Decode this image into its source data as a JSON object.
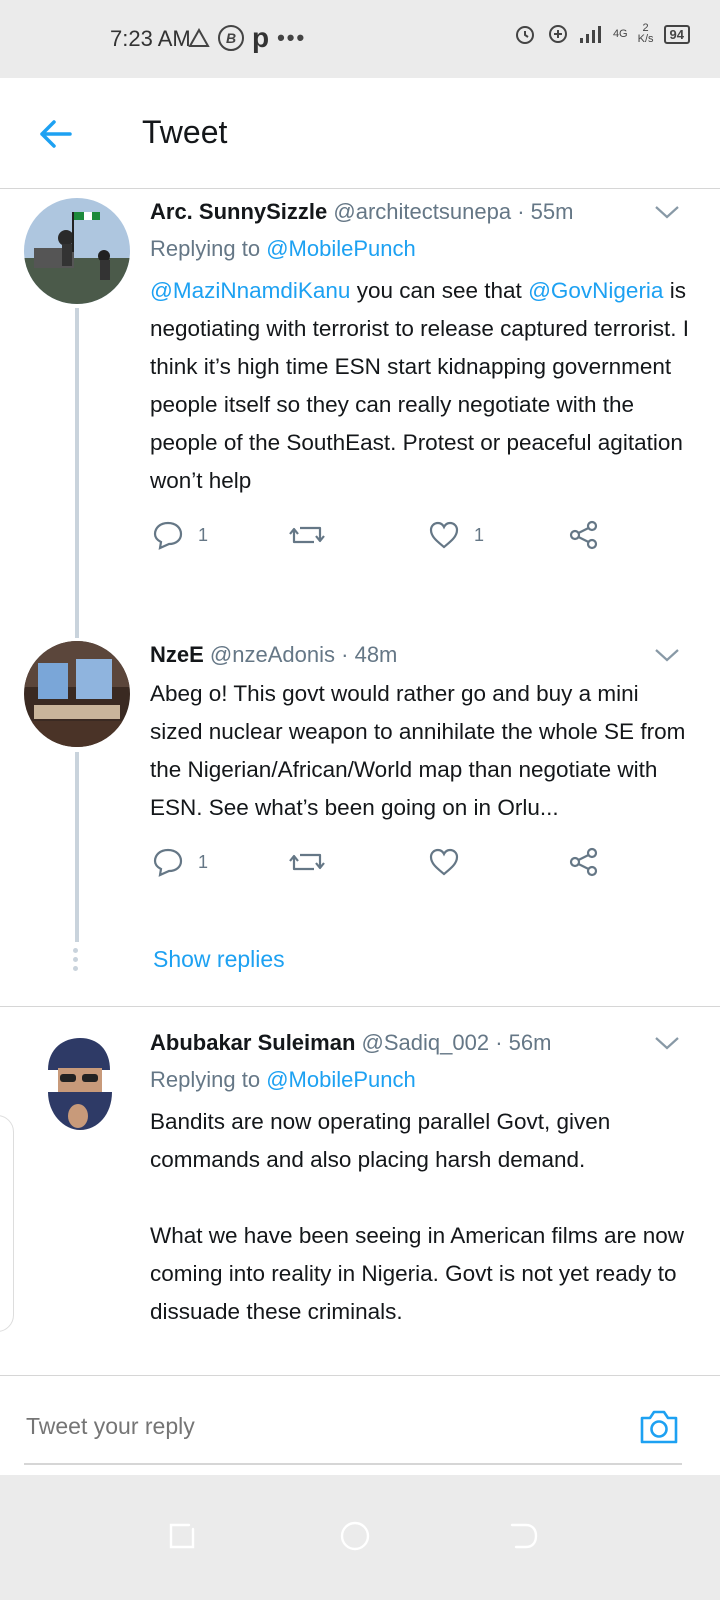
{
  "status_bar": {
    "time": "7:23 AM",
    "left_icons": [
      "warning-triangle-icon",
      "circle-b-icon",
      "p-icon",
      "more-dots-icon"
    ],
    "network": "4G",
    "speed_value": "2",
    "speed_unit": "K/s",
    "battery": "94"
  },
  "header": {
    "title": "Tweet"
  },
  "tweets": [
    {
      "name": "Arc. SunnySizzle",
      "handle": "@architectsunepa",
      "time": "55m",
      "replying_prefix": "Replying to ",
      "replying_to": "@MobilePunch",
      "text_mention1": "@MaziNnamdiKanu",
      "text_part1": " you can see that ",
      "text_mention2": "@GovNigeria",
      "text_part2": " is negotiating with terrorist to release captured terrorist. I think it’s high time ESN start kidnapping government people itself so they can really negotiate with the people of the SouthEast. Protest or peaceful agitation won’t help",
      "reply_count": "1",
      "retweet_count": "",
      "like_count": "1"
    },
    {
      "name": "NzeE",
      "handle": "@nzeAdonis",
      "time": "48m",
      "text": "Abeg o! This govt would rather go and buy a mini sized nuclear weapon to annihilate the whole SE from the Nigerian/African/World map than negotiate with ESN. See what’s been going on in Orlu...",
      "reply_count": "1",
      "retweet_count": "",
      "like_count": ""
    },
    {
      "name": "Abubakar Suleiman",
      "handle": "@Sadiq_002",
      "time": "56m",
      "replying_prefix": "Replying to ",
      "replying_to": "@MobilePunch",
      "text_p1": "Bandits are now operating parallel Govt, given commands and also placing harsh demand.",
      "text_p2": "What we have been seeing in American films are now coming into reality in Nigeria. Govt is not yet ready to dissuade these criminals."
    }
  ],
  "show_replies": "Show replies",
  "reply_bar": {
    "placeholder": "Tweet your reply"
  },
  "colors": {
    "accent": "#1da1f2",
    "secondary_text": "#657786",
    "thread_line": "#c9d3dc"
  }
}
